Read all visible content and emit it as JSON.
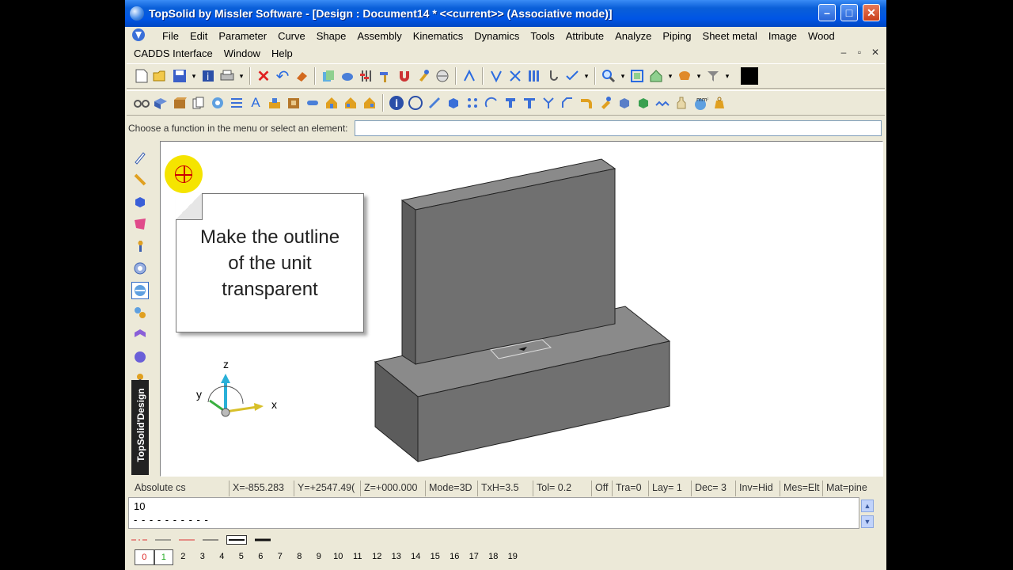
{
  "window": {
    "title": "TopSolid by Missler Software - [Design : Document14 *  <<current>> (Associative mode)]",
    "minimize": "–",
    "maximize": "□",
    "close": "✕"
  },
  "menu": {
    "row1": [
      "File",
      "Edit",
      "Parameter",
      "Curve",
      "Shape",
      "Assembly",
      "Kinematics",
      "Dynamics",
      "Tools",
      "Attribute",
      "Analyze",
      "Piping",
      "Sheet metal",
      "Image",
      "Wood"
    ],
    "row2": [
      "CADDS Interface",
      "Window",
      "Help"
    ],
    "mdi": [
      "–",
      "▫",
      "✕"
    ]
  },
  "prompt": {
    "label": "Choose a function in the menu or select an element:"
  },
  "left_toolbar": {
    "tab_label": "TopSolid'Design"
  },
  "callout": {
    "text": "Make the outline of the unit transparent"
  },
  "axes": {
    "z": "z",
    "y": "y",
    "x": "x"
  },
  "status": {
    "coord_system": "Absolute cs",
    "x": "X=-855.283",
    "y": "Y=+2547.49(",
    "z": "Z=+000.000",
    "mode": "Mode=3D",
    "txh": "TxH=3.5",
    "tol": "Tol=  0.2",
    "off": "Off",
    "tra": "Tra=0",
    "lay": "Lay=  1",
    "dec": "Dec= 3",
    "inv": "Inv=Hid",
    "mes": "Mes=Elt",
    "mat": "Mat=pine"
  },
  "command": {
    "value": "10",
    "dashes": "- - - - - - - - - -"
  },
  "layers": [
    "0",
    "1",
    "2",
    "3",
    "4",
    "5",
    "6",
    "7",
    "8",
    "9",
    "10",
    "11",
    "12",
    "13",
    "14",
    "15",
    "16",
    "17",
    "18",
    "19"
  ],
  "colors": {
    "titlebar": "#0055e5",
    "solid_front": "#707070",
    "solid_top": "#8a8a8a",
    "solid_side": "#5c5c5c",
    "highlight": "#f5e400"
  }
}
